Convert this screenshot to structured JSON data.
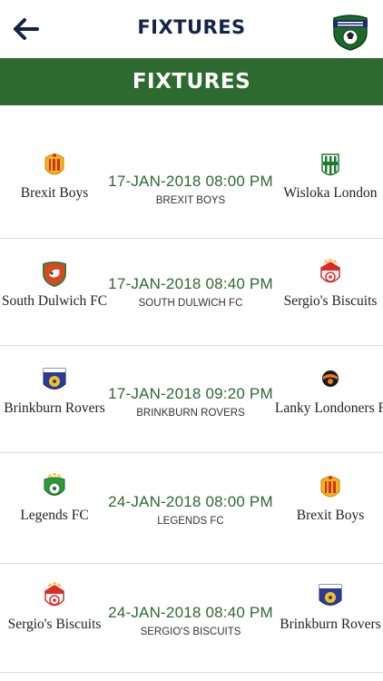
{
  "header": {
    "title": "FIXTURES",
    "logo_icon": "london-league-logo-icon",
    "back_icon": "arrow-left-icon"
  },
  "banner": {
    "title": "FIXTURES",
    "color": "#2d6a2f"
  },
  "fixtures": [
    {
      "home": "Brexit Boys",
      "away": "Wisloka London",
      "datetime": "17-JAN-2018 08:00 PM",
      "venue": "BREXIT BOYS"
    },
    {
      "home": "South Dulwich FC",
      "away": "Sergio's Biscuits",
      "datetime": "17-JAN-2018 08:40 PM",
      "venue": "SOUTH DULWICH FC"
    },
    {
      "home": "Brinkburn Rovers",
      "away": "Lanky Londoners F",
      "datetime": "17-JAN-2018 09:20 PM",
      "venue": "BRINKBURN ROVERS"
    },
    {
      "home": "Legends FC",
      "away": "Brexit Boys",
      "datetime": "24-JAN-2018 08:00 PM",
      "venue": "LEGENDS FC"
    },
    {
      "home": "Sergio's Biscuits",
      "away": "Brinkburn Rovers",
      "datetime": "24-JAN-2018 08:40 PM",
      "venue": "SERGIO'S BISCUITS"
    }
  ]
}
